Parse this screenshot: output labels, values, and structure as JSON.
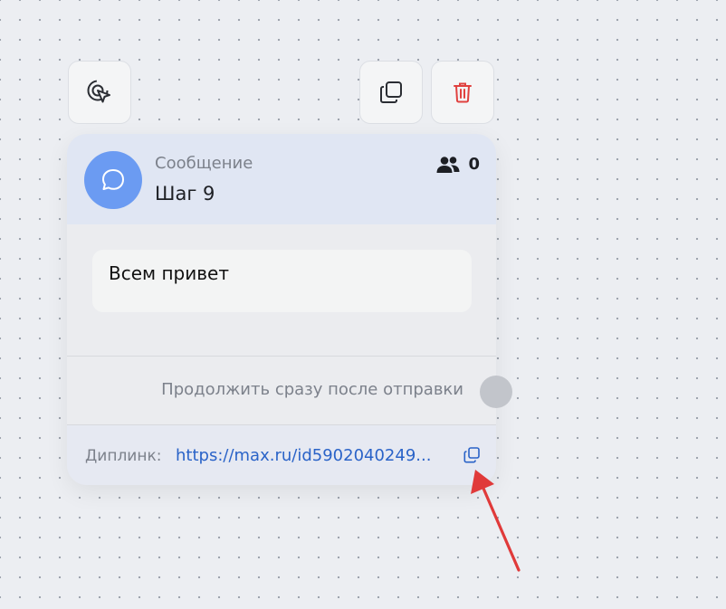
{
  "toolbar": {
    "select_icon": "cursor-click-icon",
    "copy_icon": "copy-icon",
    "delete_icon": "trash-icon",
    "delete_color": "#e0413f"
  },
  "node": {
    "type_label": "Сообщение",
    "title": "Шаг 9",
    "avatar_icon": "chat-bubble-icon",
    "avatar_color": "#6b9bf2",
    "subscribers_icon": "users-icon",
    "subscribers_count": "0",
    "message_text": "Всем привет",
    "continue_label": "Продолжить сразу после отправки",
    "continue_enabled": false,
    "deeplink_label": "Диплинк:",
    "deeplink_url": "https://max.ru/id5902040249...",
    "deeplink_copy_icon": "copy-icon",
    "link_color": "#2a63c8"
  },
  "annotation": {
    "arrow_color": "#e03a3a"
  }
}
